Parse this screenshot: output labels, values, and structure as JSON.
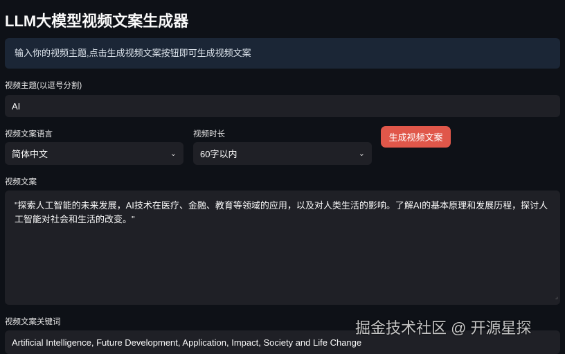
{
  "title": "LLM大模型视频文案生成器",
  "info": "输入你的视频主题,点击生成视频文案按钮即可生成视频文案",
  "topic": {
    "label": "视频主题(以逗号分割)",
    "value": "AI"
  },
  "language": {
    "label": "视频文案语言",
    "value": "简体中文"
  },
  "duration": {
    "label": "视频时长",
    "value": "60字以内"
  },
  "generate_button": "生成视频文案",
  "script": {
    "label": "视频文案",
    "value": "\"探索人工智能的未来发展，AI技术在医疗、金融、教育等领域的应用，以及对人类生活的影响。了解AI的基本原理和发展历程，探讨人工智能对社会和生活的改变。\""
  },
  "keywords": {
    "label": "视频文案关键词",
    "value": "Artificial Intelligence, Future Development, Application, Impact, Society and Life Change"
  },
  "watermark": "掘金技术社区 @ 开源星探"
}
